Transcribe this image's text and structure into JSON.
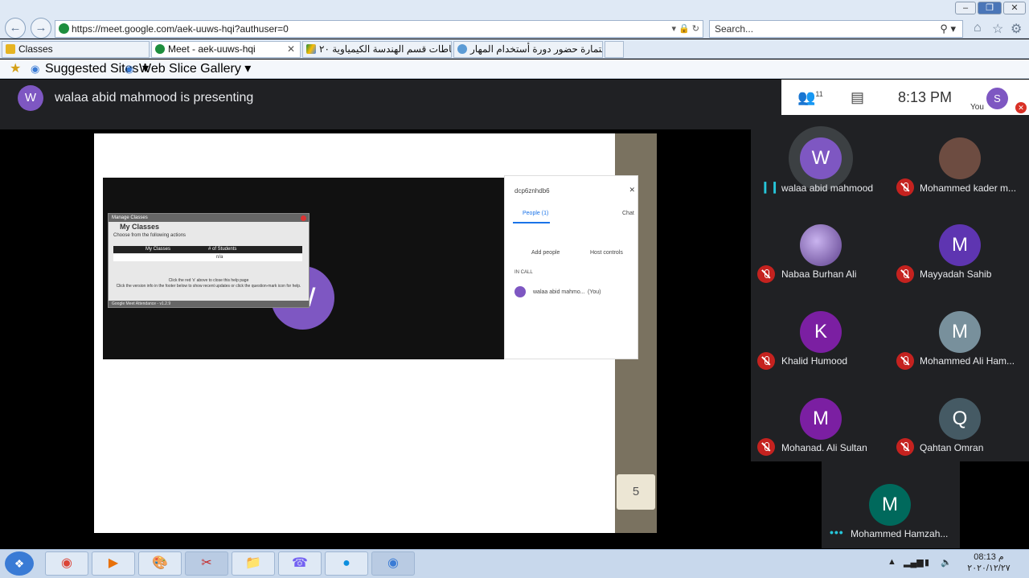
{
  "browser": {
    "url": "https://meet.google.com/aek-uuws-hqi?authuser=0",
    "search_placeholder": "Search...",
    "tabs": [
      {
        "label": "Classes"
      },
      {
        "label": "Meet - aek-uuws-hqi"
      },
      {
        "label": "نشاطات قسم الهندسة الكيمياوية ٢٠..."
      },
      {
        "label": "استمارة حضور دورة أستخدام المهار..."
      }
    ],
    "favorites": [
      {
        "label": "Suggested Sites"
      },
      {
        "label": "Web Slice Gallery"
      }
    ]
  },
  "meet": {
    "presenter_initial": "W",
    "presenter_text": "walaa abid mahmood is presenting",
    "participant_count": "11",
    "time": "8:13  PM",
    "you_label": "You",
    "you_initial": "S",
    "slide_page": "5",
    "participants": [
      {
        "name": "walaa abid mahmood",
        "initial": "W",
        "color": "#7e57c2"
      },
      {
        "name": "Mohammed kader m...",
        "initial": "",
        "color": "#6d4c41"
      },
      {
        "name": "Nabaa Burhan Ali",
        "initial": "",
        "color": "#7b5aa6"
      },
      {
        "name": "Mayyadah Sahib",
        "initial": "M",
        "color": "#5e35b1"
      },
      {
        "name": "Khalid Humood",
        "initial": "K",
        "color": "#7b1fa2"
      },
      {
        "name": "Mohammed Ali Ham...",
        "initial": "M",
        "color": "#78909c"
      },
      {
        "name": "Mohanad. Ali Sultan",
        "initial": "M",
        "color": "#7b1fa2"
      },
      {
        "name": "Qahtan Omran",
        "initial": "Q",
        "color": "#455a64"
      },
      {
        "name": "Mohammed Hamzah...",
        "initial": "M",
        "color": "#00695c"
      }
    ]
  },
  "inner_screen": {
    "avatar_initial": "W",
    "manage_header": "Manage Classes",
    "manage_title": "My Classes",
    "manage_subtitle": "Choose from the following actions",
    "col1": "My Classes",
    "col2": "# of Students",
    "cell": "n/a",
    "help1": "Click the red 'x' above to close this help page",
    "help2": "Click the version info in the footer below to show recent updates or click the question-mark icon for help.",
    "footer": "Google Meet Attendance - v1.2.9",
    "meeting_code": "dcp6znhdb6",
    "people_tab": "People (1)",
    "chat_tab": "Chat",
    "add_people": "Add people",
    "host_controls": "Host controls",
    "in_call": "IN CALL",
    "self_name": "walaa abid mahmo...",
    "self_tag": "(You)"
  },
  "taskbar": {
    "time": "08:13 م",
    "date": "٢٠٢٠/١٢/٢٧"
  }
}
